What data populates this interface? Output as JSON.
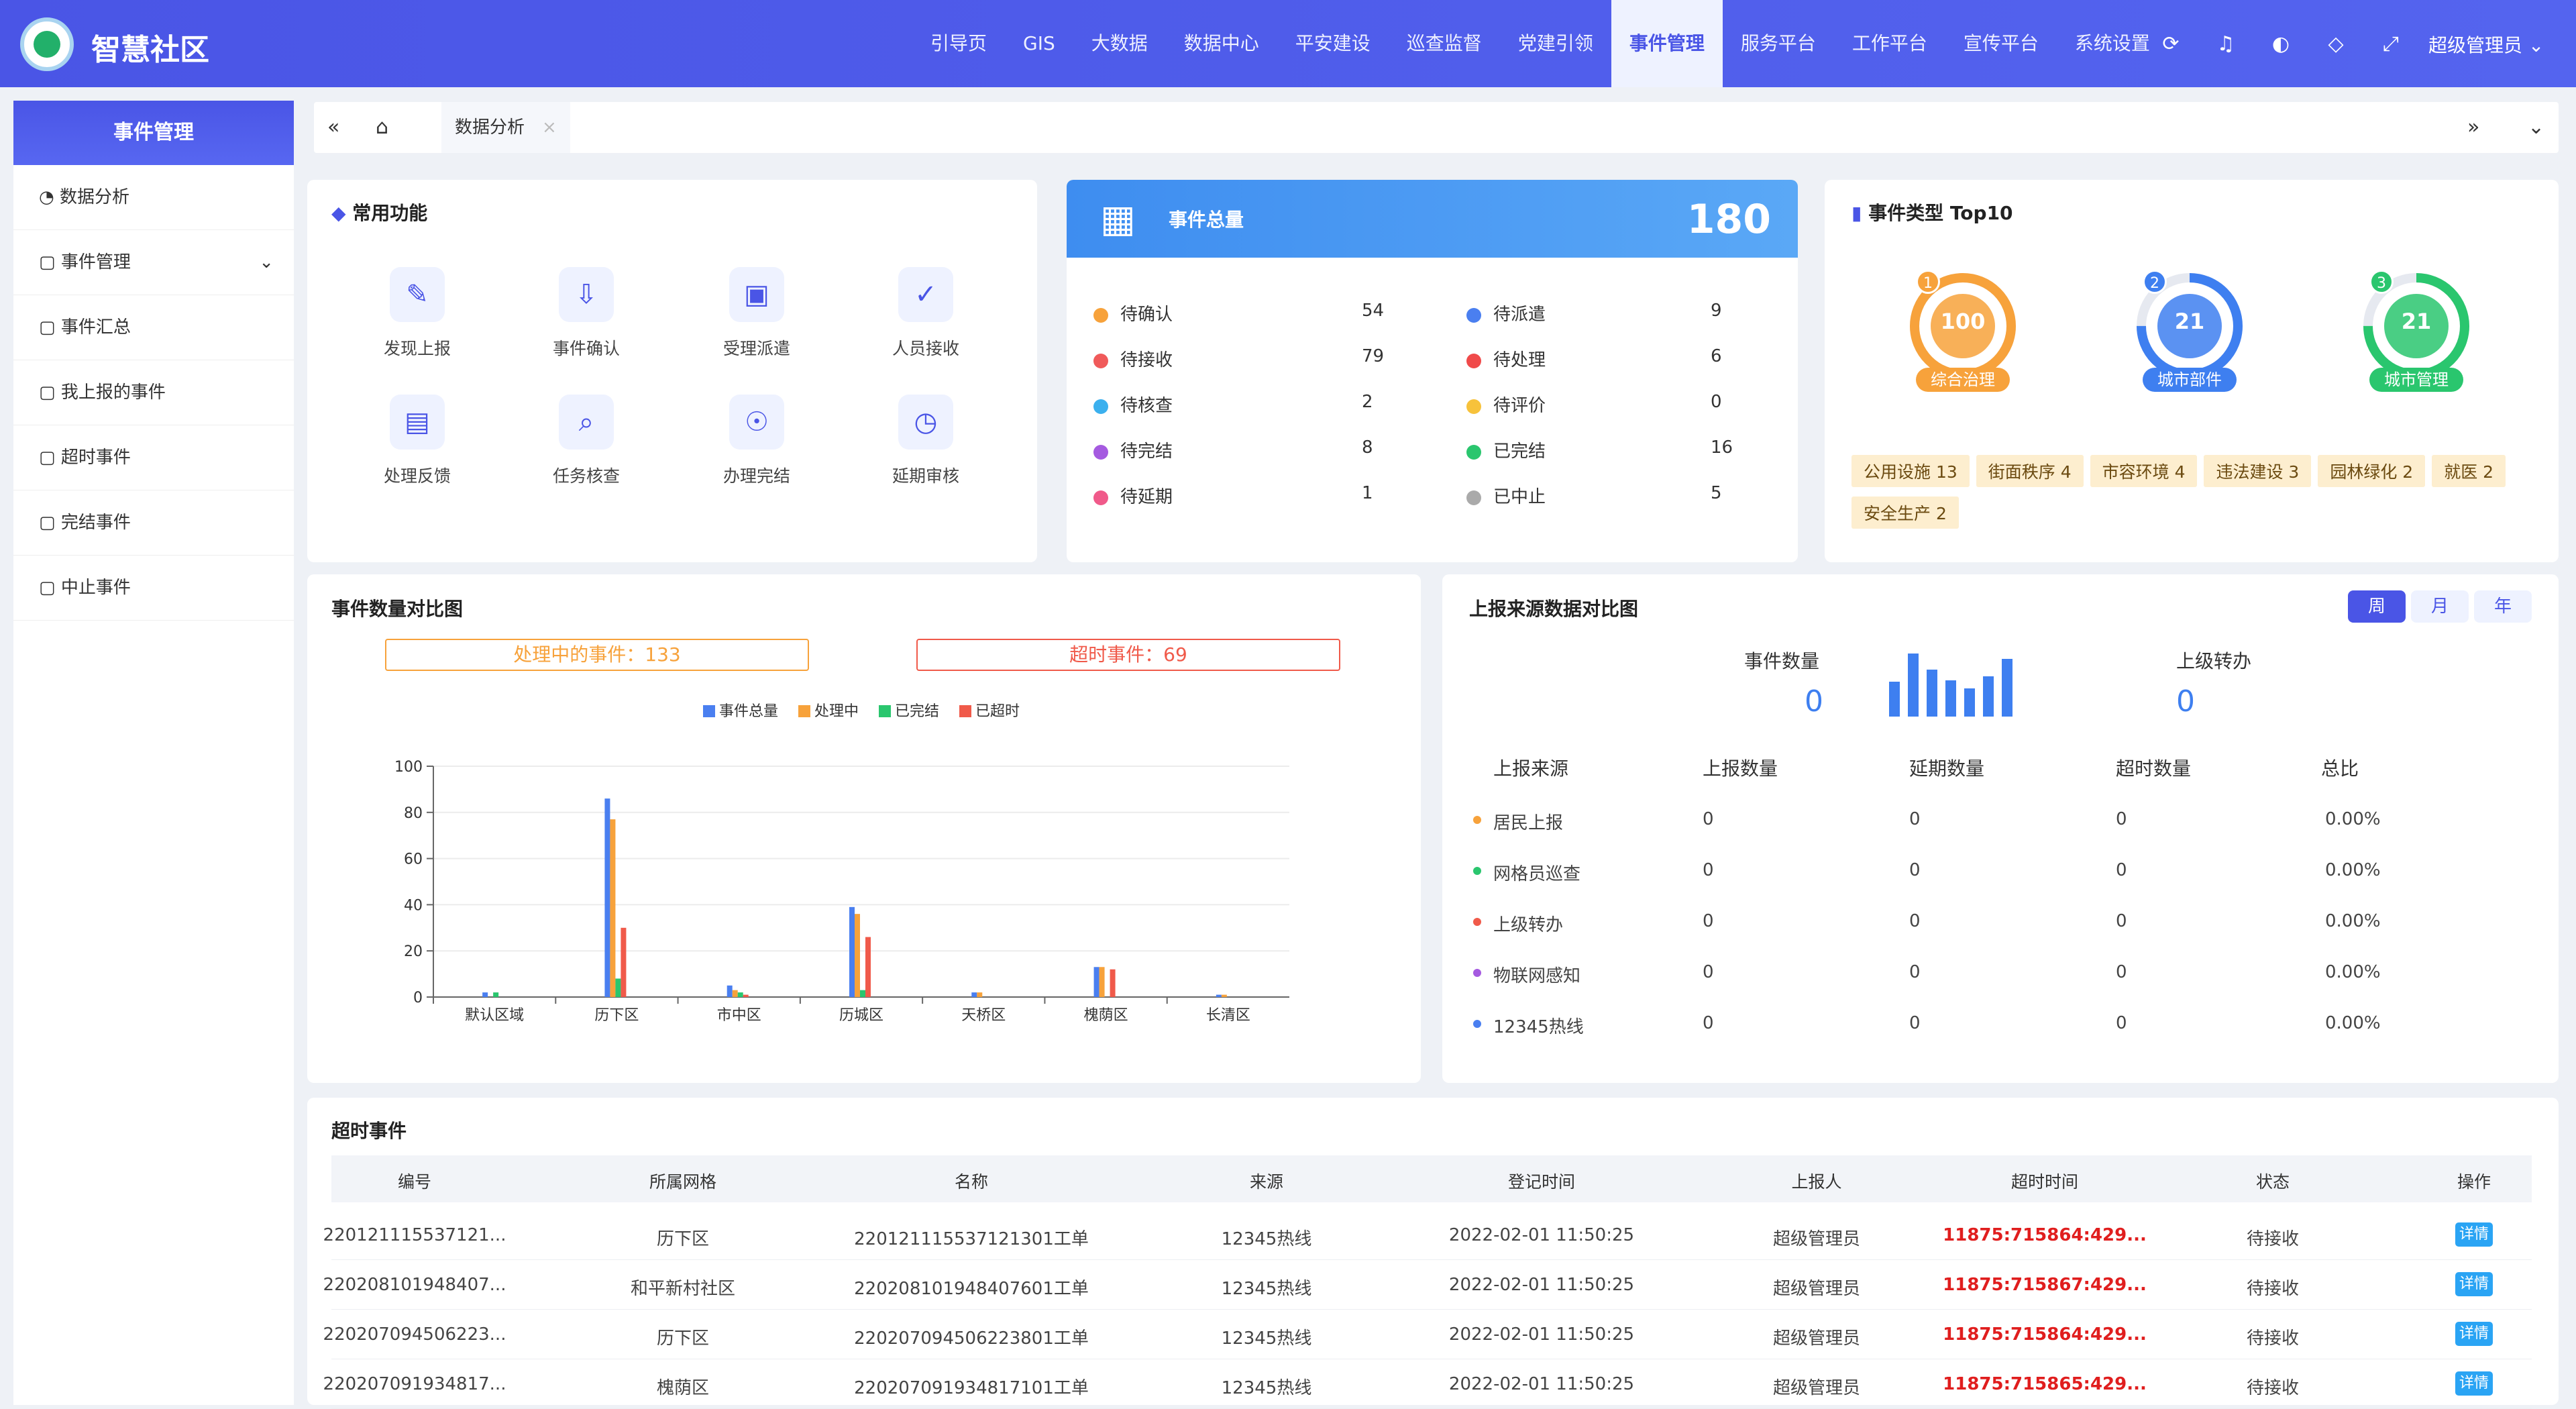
{
  "app": {
    "title": "智慧社区",
    "user": "超级管理员"
  },
  "topnav": [
    "引导页",
    "GIS",
    "大数据",
    "数据中心",
    "平安建设",
    "巡查监督",
    "党建引领",
    "事件管理",
    "服务平台",
    "工作平台",
    "宣传平台",
    "系统设置"
  ],
  "sidebar": {
    "header": "事件管理",
    "items": [
      {
        "label": "数据分析"
      },
      {
        "label": "事件管理"
      },
      {
        "label": "事件汇总"
      },
      {
        "label": "我上报的事件"
      },
      {
        "label": "超时事件"
      },
      {
        "label": "完结事件"
      },
      {
        "label": "中止事件"
      }
    ]
  },
  "tab": {
    "label": "数据分析",
    "close": "×"
  },
  "common": {
    "title": "常用功能",
    "items": [
      "发现上报",
      "事件确认",
      "受理派遣",
      "人员接收",
      "处理反馈",
      "任务核查",
      "办理完结",
      "延期审核"
    ]
  },
  "total": {
    "title": "事件总量",
    "value": "180",
    "left": [
      {
        "label": "待确认",
        "value": "54",
        "color": "#f7a23b"
      },
      {
        "label": "待接收",
        "value": "79",
        "color": "#f05a5a"
      },
      {
        "label": "待核查",
        "value": "2",
        "color": "#3bb0ee"
      },
      {
        "label": "待完结",
        "value": "8",
        "color": "#a55ae0"
      },
      {
        "label": "待延期",
        "value": "1",
        "color": "#f05a8a"
      }
    ],
    "right": [
      {
        "label": "待派遣",
        "value": "9",
        "color": "#4a7ff0"
      },
      {
        "label": "待处理",
        "value": "6",
        "color": "#f04a4a"
      },
      {
        "label": "待评价",
        "value": "0",
        "color": "#f7c23b"
      },
      {
        "label": "已完结",
        "value": "16",
        "color": "#2ac66e"
      },
      {
        "label": "已中止",
        "value": "5",
        "color": "#aaaaaa"
      }
    ]
  },
  "top10": {
    "title": "事件类型 Top10",
    "rings": [
      {
        "rank": "1",
        "value": "100",
        "label": "综合治理",
        "color": "#f7a23b",
        "fill": 1.0
      },
      {
        "rank": "2",
        "value": "21",
        "label": "城市部件",
        "color": "#3e7ff0",
        "fill": 0.75
      },
      {
        "rank": "3",
        "value": "21",
        "label": "城市管理",
        "color": "#2ac66e",
        "fill": 0.75
      }
    ],
    "tags": [
      {
        "name": "公用设施",
        "count": "13"
      },
      {
        "name": "街面秩序",
        "count": "4"
      },
      {
        "name": "市容环境",
        "count": "4"
      },
      {
        "name": "违法建设",
        "count": "3"
      },
      {
        "name": "园林绿化",
        "count": "2"
      },
      {
        "name": "就医",
        "count": "2"
      },
      {
        "name": "安全生产",
        "count": "2"
      }
    ]
  },
  "compare": {
    "title": "事件数量对比图",
    "processing": "处理中的事件：133",
    "overtime": "超时事件：69",
    "colors": {
      "总量": "#4a7ff0",
      "处理中": "#f7a23b",
      "已完结": "#2ac66e",
      "已超时": "#f05a4a"
    }
  },
  "chart_data": {
    "type": "bar",
    "categories": [
      "默认区域",
      "历下区",
      "市中区",
      "历城区",
      "天桥区",
      "槐荫区",
      "长清区"
    ],
    "series": [
      {
        "name": "事件总量",
        "values": [
          2,
          86,
          5,
          39,
          2,
          13,
          1
        ]
      },
      {
        "name": "处理中",
        "values": [
          0,
          77,
          3,
          36,
          2,
          13,
          1
        ]
      },
      {
        "name": "已完结",
        "values": [
          2,
          8,
          2,
          3,
          0,
          0,
          0
        ]
      },
      {
        "name": "已超时",
        "values": [
          0,
          30,
          1,
          26,
          0,
          12,
          0
        ]
      }
    ],
    "ylim": [
      0,
      100
    ],
    "yticks": [
      0,
      20,
      40,
      60,
      80,
      100
    ],
    "legend": "top"
  },
  "source": {
    "title": "上报来源数据对比图",
    "periods": [
      "周",
      "月",
      "年"
    ],
    "event_count_label": "事件数量",
    "event_count": "0",
    "transfer_label": "上级转办",
    "transfer": "0",
    "headers": [
      "上报来源",
      "上报数量",
      "延期数量",
      "超时数量",
      "总比"
    ],
    "rows": [
      {
        "name": "居民上报",
        "color": "#f7a23b",
        "c": "0",
        "d": "0",
        "o": "0",
        "p": "0.00%"
      },
      {
        "name": "网格员巡查",
        "color": "#2ac66e",
        "c": "0",
        "d": "0",
        "o": "0",
        "p": "0.00%"
      },
      {
        "name": "上级转办",
        "color": "#f05a4a",
        "c": "0",
        "d": "0",
        "o": "0",
        "p": "0.00%"
      },
      {
        "name": "物联网感知",
        "color": "#a55ae0",
        "c": "0",
        "d": "0",
        "o": "0",
        "p": "0.00%"
      },
      {
        "name": "12345热线",
        "color": "#4a7ff0",
        "c": "0",
        "d": "0",
        "o": "0",
        "p": "0.00%"
      }
    ]
  },
  "overtime": {
    "title": "超时事件",
    "headers": [
      "编号",
      "所属网格",
      "名称",
      "来源",
      "登记时间",
      "上报人",
      "超时时间",
      "状态",
      "操作"
    ],
    "rows": [
      {
        "id": "220121115537121...",
        "grid": "历下区",
        "name": "220121115537121301工单",
        "src": "12345热线",
        "time": "2022-02-01 11:50:25",
        "reporter": "超级管理员",
        "over": "11875:715864:429...",
        "status": "待接收",
        "op": "详情"
      },
      {
        "id": "220208101948407...",
        "grid": "和平新村社区",
        "name": "220208101948407601工单",
        "src": "12345热线",
        "time": "2022-02-01 11:50:25",
        "reporter": "超级管理员",
        "over": "11875:715867:429...",
        "status": "待接收",
        "op": "详情"
      },
      {
        "id": "220207094506223...",
        "grid": "历下区",
        "name": "220207094506223801工单",
        "src": "12345热线",
        "time": "2022-02-01 11:50:25",
        "reporter": "超级管理员",
        "over": "11875:715864:429...",
        "status": "待接收",
        "op": "详情"
      },
      {
        "id": "220207091934817...",
        "grid": "槐荫区",
        "name": "220207091934817101工单",
        "src": "12345热线",
        "time": "2022-02-01 11:50:25",
        "reporter": "超级管理员",
        "over": "11875:715865:429...",
        "status": "待接收",
        "op": "详情"
      }
    ]
  }
}
